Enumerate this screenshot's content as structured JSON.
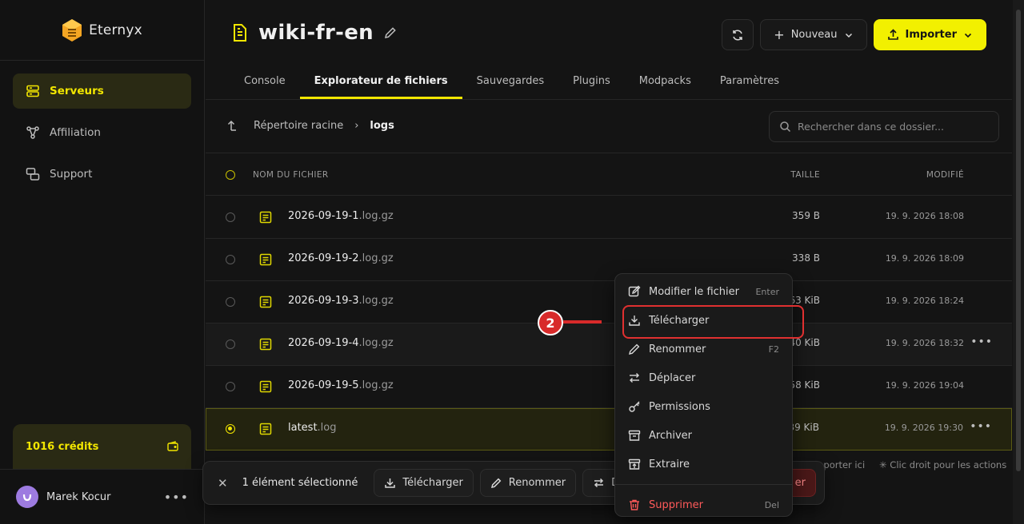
{
  "brand": {
    "name": "Eternyx"
  },
  "sidebar": {
    "items": [
      {
        "label": "Serveurs",
        "icon": "server-icon",
        "active": true
      },
      {
        "label": "Affiliation",
        "icon": "share-icon",
        "active": false
      },
      {
        "label": "Support",
        "icon": "chat-icon",
        "active": false
      }
    ],
    "credits": "1016 crédits",
    "user": {
      "name": "Marek Kocur"
    }
  },
  "header": {
    "title": "wiki-fr-en",
    "new_label": "Nouveau",
    "import_label": "Importer"
  },
  "tabs": [
    {
      "label": "Console"
    },
    {
      "label": "Explorateur de fichiers",
      "active": true
    },
    {
      "label": "Sauvegardes"
    },
    {
      "label": "Plugins"
    },
    {
      "label": "Modpacks"
    },
    {
      "label": "Paramètres"
    }
  ],
  "breadcrumb": {
    "root": "Répertoire racine",
    "current": "logs"
  },
  "search": {
    "placeholder": "Rechercher dans ce dossier..."
  },
  "table": {
    "headers": {
      "name": "NOM DU FICHIER",
      "size": "TAILLE",
      "modified": "MODIFIÉ"
    },
    "rows": [
      {
        "base": "2026-09-19-1",
        "ext": ".log.gz",
        "size": "359 B",
        "date": "19. 9. 2026 18:08"
      },
      {
        "base": "2026-09-19-2",
        "ext": ".log.gz",
        "size": "338 B",
        "date": "19. 9. 2026 18:09"
      },
      {
        "base": "2026-09-19-3",
        "ext": ".log.gz",
        "size": "63 KiB",
        "date": "19. 9. 2026 18:24"
      },
      {
        "base": "2026-09-19-4",
        "ext": ".log.gz",
        "size": "40 KiB",
        "date": "19. 9. 2026 18:32"
      },
      {
        "base": "2026-09-19-5",
        "ext": ".log.gz",
        "size": "58 KiB",
        "date": "19. 9. 2026 19:04"
      },
      {
        "base": "latest",
        "ext": ".log",
        "size": "39 KiB",
        "date": "19. 9. 2026 19:30"
      }
    ]
  },
  "hints": {
    "import": "importer ici",
    "right_click": "Clic droit pour les actions"
  },
  "selection_bar": {
    "count": "1 élément sélectionné",
    "download": "Télécharger",
    "rename": "Renommer",
    "move_partial": "D",
    "delete_partial": "er"
  },
  "context_menu": {
    "items": [
      {
        "label": "Modifier le fichier",
        "kbd": "Enter"
      },
      {
        "label": "Télécharger",
        "kbd": ""
      },
      {
        "label": "Renommer",
        "kbd": "F2"
      },
      {
        "label": "Déplacer",
        "kbd": ""
      },
      {
        "label": "Permissions",
        "kbd": ""
      },
      {
        "label": "Archiver",
        "kbd": ""
      },
      {
        "label": "Extraire",
        "kbd": ""
      }
    ],
    "delete": {
      "label": "Supprimer",
      "kbd": "Del"
    }
  },
  "annotation": {
    "step": "2"
  },
  "colors": {
    "accent": "#f2e600",
    "danger": "#ff5a5a",
    "highlight": "#e03030"
  }
}
